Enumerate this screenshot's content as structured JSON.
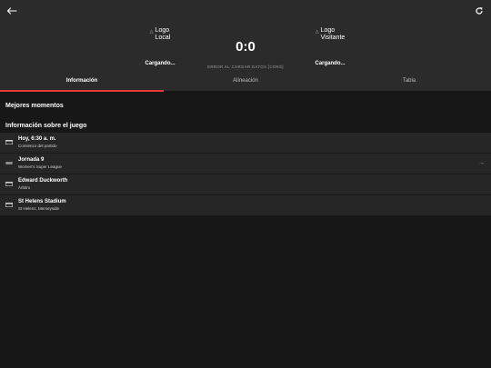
{
  "header": {
    "back_icon": "arrow-left-icon",
    "refresh_icon": "refresh-icon"
  },
  "match": {
    "home": {
      "logo_alt": "Logo\nLocal",
      "name": "Cargando..."
    },
    "away": {
      "logo_alt": "Logo\nVisitante",
      "name": "Cargando..."
    },
    "score": "0:0",
    "status": "ERROR AL CARGAR DATOS (CORS)"
  },
  "tabs": [
    {
      "label": "Información"
    },
    {
      "label": "Alineación"
    },
    {
      "label": "Tabla"
    }
  ],
  "sections": {
    "highlights_title": "Mejores momentos",
    "info_title": "Información sobre el juego"
  },
  "info_rows": [
    {
      "title": "Hoy, 6:30 a. m.",
      "subtitle": "Comienzo del partido",
      "icon": "calendar-icon"
    },
    {
      "title": "Jornada 9",
      "subtitle": "Women's Super League",
      "icon": "competition-icon",
      "arrow": "→"
    },
    {
      "title": "Edward Duckworth",
      "subtitle": "Árbitro",
      "icon": "referee-icon"
    },
    {
      "title": "St Helens Stadium",
      "subtitle": "St Helens, Merseyside",
      "icon": "stadium-icon"
    }
  ],
  "colors": {
    "accent": "#e53935",
    "header_bg": "#2b2b2b",
    "page_bg": "#171717",
    "row_bg": "#262626"
  }
}
